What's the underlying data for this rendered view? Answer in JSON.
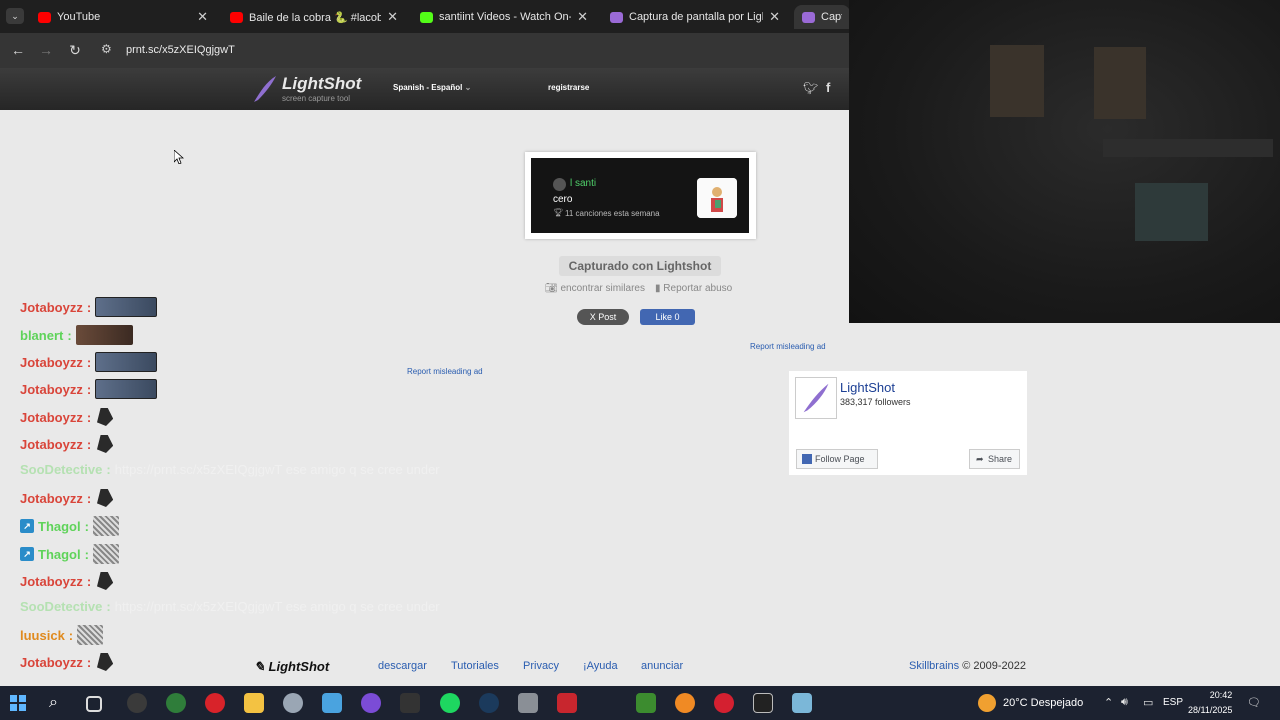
{
  "browser": {
    "tabs": [
      {
        "label": "YouTube",
        "color": "#ff0000"
      },
      {
        "label": "Baile de la cobra 🐍 #lacobra #",
        "color": "#ff0000"
      },
      {
        "label": "santiint Videos - Watch On-De",
        "color": "#53fc18"
      },
      {
        "label": "Captura de pantalla por Lightsh",
        "color": "#9a6ad6"
      },
      {
        "label": "Captu",
        "color": "#9a6ad6"
      }
    ],
    "address": "prnt.sc/x5zXEIQgjgwT"
  },
  "lightshot": {
    "logo": "LightShot",
    "tagline": "screen capture tool",
    "language": "Spanish - Español",
    "register": "registrarse",
    "screenshot": {
      "user": "l santi",
      "title": "cero",
      "subtitle": "11 canciones esta semana"
    },
    "captured_label": "Capturado con Lightshot",
    "find_similar": "encontrar similares",
    "report_abuse": "Reportar abuso",
    "x_post": "X Post",
    "fb_like": "Like 0",
    "report_ad": "Report misleading ad",
    "fb_widget": {
      "page_name": "LightShot",
      "followers": "383,317 followers",
      "follow": "Follow Page",
      "share": "Share"
    },
    "footer": {
      "logo": "LightShot",
      "links": [
        "descargar",
        "Tutoriales",
        "Privacy",
        "¡Ayuda",
        "anunciar"
      ],
      "company": "Skillbrains",
      "copyright": "© 2009-2022"
    }
  },
  "chat": [
    {
      "user": "Jotaboyzz",
      "emote": "face"
    },
    {
      "user": "blanert",
      "emote": "face2"
    },
    {
      "user": "Jotaboyzz",
      "emote": "face"
    },
    {
      "user": "Jotaboyzz",
      "emote": "face"
    },
    {
      "user": "Jotaboyzz",
      "emote": "dark"
    },
    {
      "user": "Jotaboyzz",
      "emote": "dark"
    },
    {
      "user": "SooDetective",
      "message": "https://prnt.sc/x5zXEIQgjgwT ese amigo q se cree under"
    },
    {
      "user": "Jotaboyzz",
      "emote": "dark"
    },
    {
      "user": "Thagol",
      "emote": "sketch"
    },
    {
      "user": "Thagol",
      "emote": "sketch"
    },
    {
      "user": "Jotaboyzz",
      "emote": "dark"
    },
    {
      "user": "SooDetective",
      "message": "https://prnt.sc/x5zXEIQgjgwT ese amigo q se cree under"
    },
    {
      "user": "luusick",
      "emote": "sketch"
    },
    {
      "user": "Jotaboyzz",
      "emote": "dark"
    }
  ],
  "taskbar": {
    "weather": "20°C  Despejado",
    "language": "ESP",
    "time": "20:42",
    "date": "28/11/2025"
  }
}
